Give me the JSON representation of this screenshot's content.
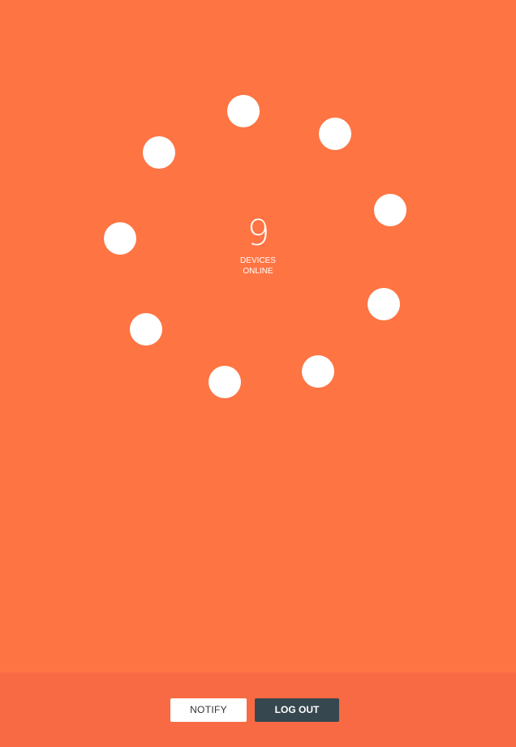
{
  "status": {
    "count": "9",
    "caption_line1": "DEVICES",
    "caption_line2": "ONLINE"
  },
  "devices": [
    {
      "name": "device-1",
      "icon": "circle"
    },
    {
      "name": "device-2",
      "icon": "circle"
    },
    {
      "name": "device-3",
      "icon": "circle"
    },
    {
      "name": "device-4",
      "icon": "circle"
    },
    {
      "name": "device-5",
      "icon": "circle"
    },
    {
      "name": "device-6",
      "icon": "circle"
    },
    {
      "name": "device-7",
      "icon": "circle"
    },
    {
      "name": "device-8",
      "icon": "circle"
    },
    {
      "name": "device-9",
      "icon": "circle"
    }
  ],
  "footer": {
    "notify_label": "NOTIFY",
    "logout_label": "LOG OUT"
  },
  "colors": {
    "background": "#ff7443",
    "footer_background": "#f76a43",
    "dot": "#ffffff",
    "logout_button": "#37474f",
    "notify_button": "#ffffff"
  }
}
